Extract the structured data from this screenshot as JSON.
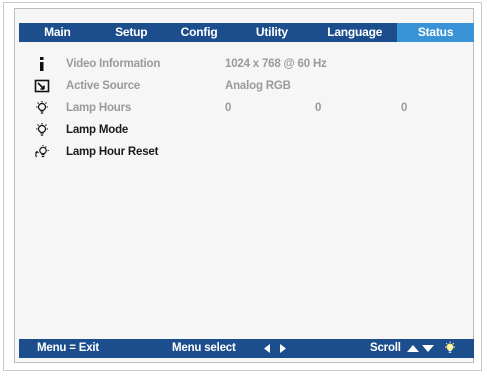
{
  "tabs": [
    {
      "label": "Main"
    },
    {
      "label": "Setup"
    },
    {
      "label": "Config"
    },
    {
      "label": "Utility"
    },
    {
      "label": "Language"
    },
    {
      "label": "Status",
      "active": true
    }
  ],
  "rows": [
    {
      "icon": "info-icon",
      "label": "Video Information",
      "value": "1024  x  768  @  60 Hz"
    },
    {
      "icon": "input-source-icon",
      "label": "Active Source",
      "value": "Analog RGB"
    },
    {
      "icon": "lamp-icon",
      "label": "Lamp Hours",
      "values": [
        "0",
        "0",
        "0"
      ]
    },
    {
      "icon": "lamp-icon",
      "label": "Lamp Mode"
    },
    {
      "icon": "lamp-reset-icon",
      "label": "Lamp Hour Reset"
    }
  ],
  "footer": {
    "exit": "Menu = Exit",
    "select": "Menu select",
    "scroll": "Scroll"
  },
  "colors": {
    "bar": "#1c4e8e",
    "active_tab": "#3a93d6",
    "disabled_text": "#9a9a9a",
    "enabled_text": "#1a1a1a"
  }
}
